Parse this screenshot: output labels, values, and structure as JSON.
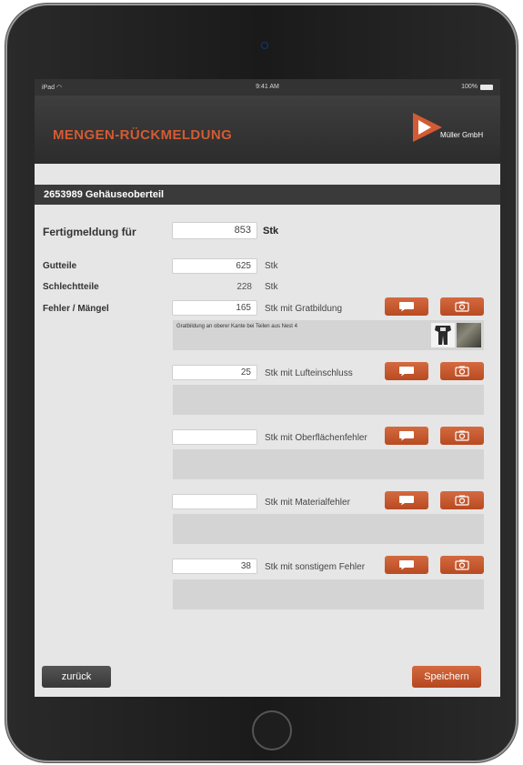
{
  "statusbar": {
    "carrier": "iPad",
    "time": "9:41 AM",
    "battery": "100%"
  },
  "header": {
    "title": "MENGEN-RÜCKMELDUNG",
    "company": "Müller GmbH"
  },
  "order": {
    "title": "2653989 Gehäuseoberteil"
  },
  "completion": {
    "label": "Fertigmeldung für",
    "value": "853",
    "unit": "Stk"
  },
  "good_parts": {
    "label": "Gutteile",
    "value": "625",
    "unit": "Stk"
  },
  "bad_parts": {
    "label": "Schlechtteile",
    "value": "228",
    "unit": "Stk"
  },
  "defects": {
    "label": "Fehler / Mängel",
    "items": [
      {
        "value": "165",
        "unit": "Stk mit Gratbildung",
        "note": "Gratbildung an oberer Kante bei Teilen aus Nest 4"
      },
      {
        "value": "25",
        "unit": "Stk mit Lufteinschluss",
        "note": ""
      },
      {
        "value": "",
        "unit": "Stk mit Oberflächenfehler",
        "note": ""
      },
      {
        "value": "",
        "unit": "Stk mit Materialfehler",
        "note": ""
      },
      {
        "value": "38",
        "unit": "Stk mit sonstigem Fehler",
        "note": ""
      }
    ]
  },
  "footer": {
    "back_label": "zurück",
    "save_label": "Speichern"
  },
  "colors": {
    "accent": "#d35b33",
    "button": "#c4562c",
    "header": "#333333",
    "screen_bg": "#e6e6e6"
  },
  "icons": {
    "comment": "speech-bubble-icon",
    "photo": "camera-icon"
  }
}
